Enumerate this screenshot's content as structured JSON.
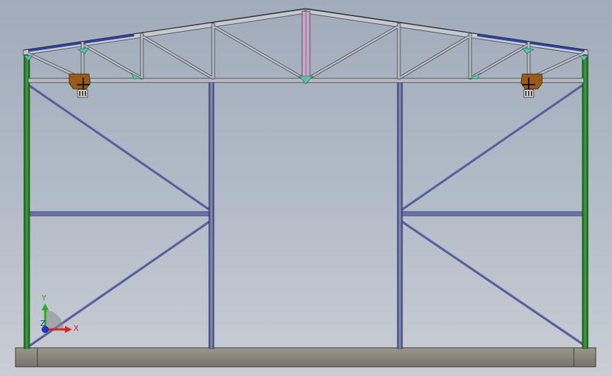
{
  "viewport": {
    "name": "cad-graphics-viewport",
    "background_top": "#a1abba",
    "background_bottom": "#c9ced4"
  },
  "colors": {
    "column": "#2f8a2f",
    "column_dark": "#1d5a1d",
    "brace": "#5a5e96",
    "brace_light": "#8d91c4",
    "truss": "#b7bcc2",
    "truss_dark": "#4a4e55",
    "purlin_blue": "#2a3fa8",
    "gusset": "#5ec1a7",
    "bracket": "#9a5a18",
    "foundation": "#868278",
    "foundation_dark": "#3e3c38"
  },
  "triad": {
    "x_label": "X",
    "y_label": "Y",
    "z_label": "Z",
    "x_color": "#e02020",
    "y_color": "#20b020",
    "z_color": "#2030e0"
  }
}
